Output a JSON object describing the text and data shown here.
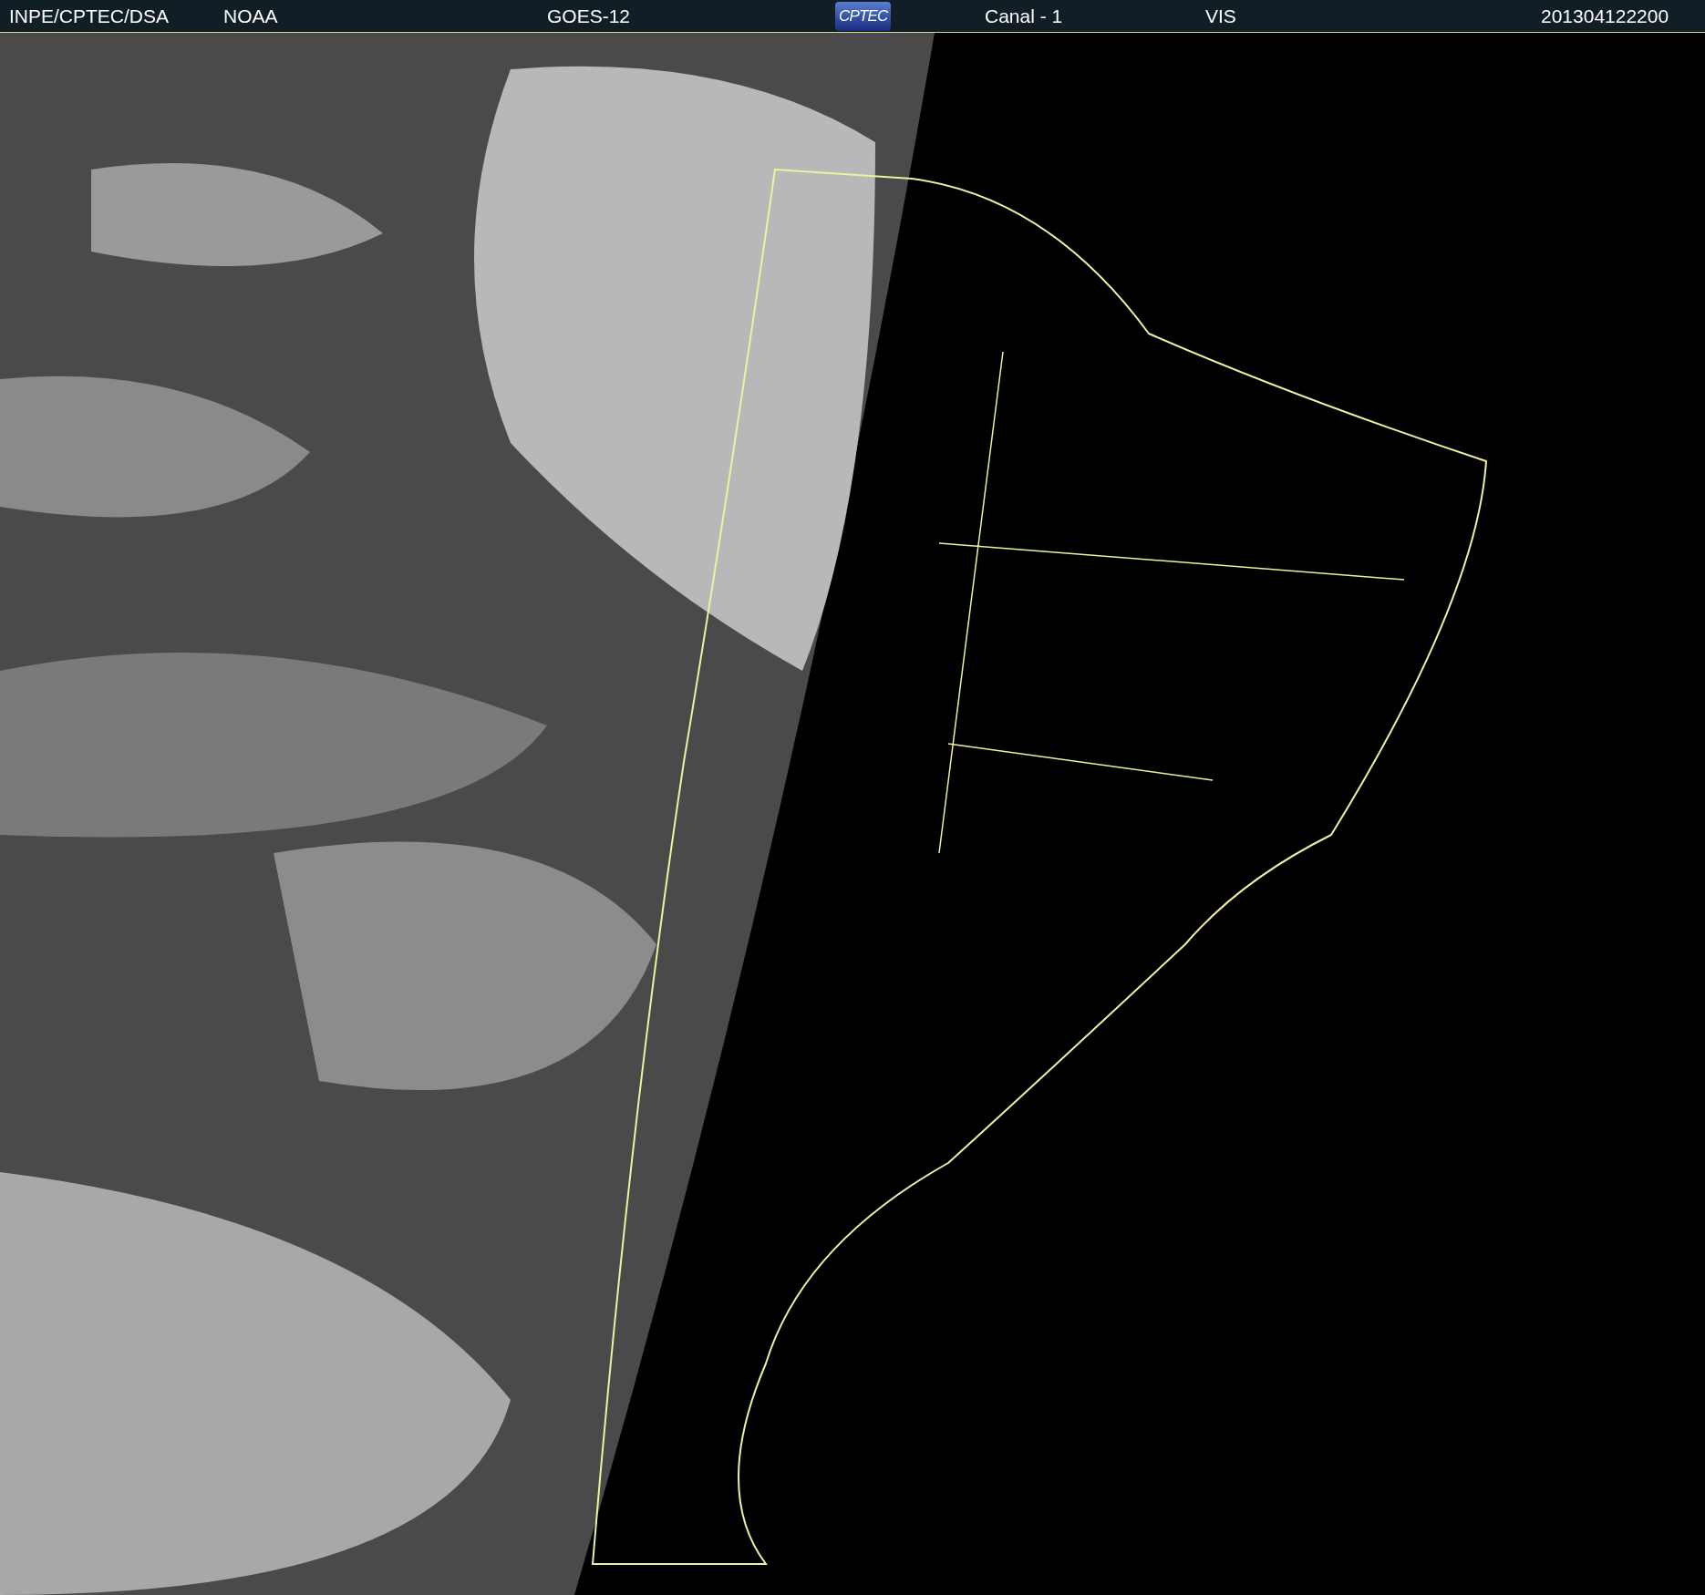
{
  "header": {
    "items": [
      {
        "kind": "text",
        "text": "INPE/CPTEC/DSA"
      },
      {
        "kind": "text",
        "text": "NOAA"
      },
      {
        "kind": "text",
        "text": "GOES-12"
      },
      {
        "kind": "logo",
        "text": "CPTEC"
      },
      {
        "kind": "text",
        "text": "Canal - 1"
      },
      {
        "kind": "text",
        "text": "VIS"
      },
      {
        "kind": "text",
        "text": "201304122200"
      }
    ]
  }
}
